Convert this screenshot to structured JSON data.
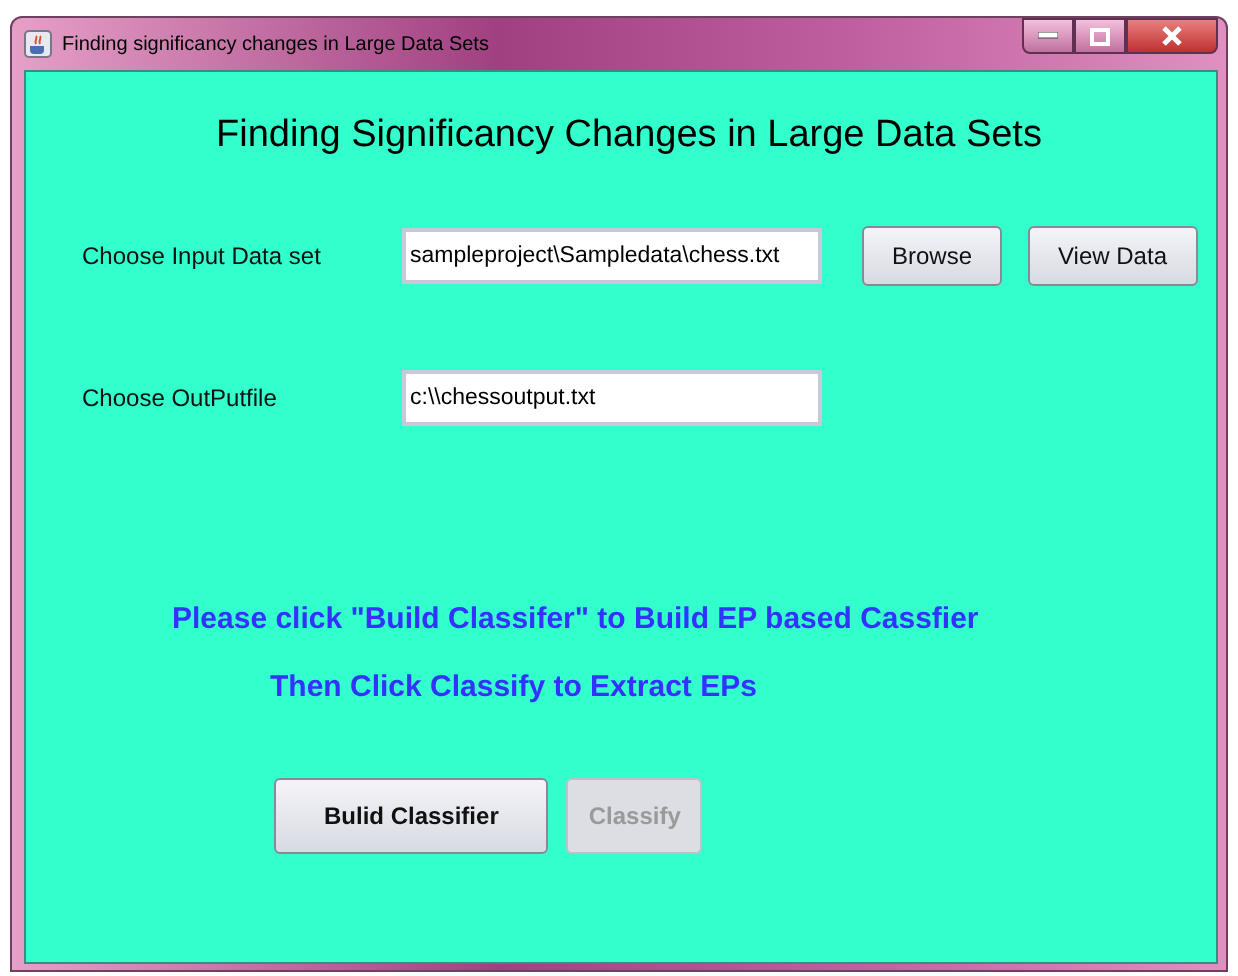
{
  "window": {
    "title": "Finding significancy changes in Large Data Sets"
  },
  "heading": "Finding Significancy Changes in Large Data Sets",
  "input_row": {
    "label": "Choose Input Data set",
    "value": "sampleproject\\Sampledata\\chess.txt",
    "buttons": [
      {
        "label": "Browse",
        "disabled": false
      },
      {
        "label": "View Data",
        "disabled": false
      }
    ]
  },
  "output_row": {
    "label": "Choose OutPutfile",
    "value": "c:\\\\chessoutput.txt"
  },
  "messages": [
    "Please click \"Build Classifer\" to Build EP based Cassfier",
    "Then Click Classify to Extract EPs"
  ],
  "actions": [
    {
      "label": "Bulid Classifier",
      "disabled": false
    },
    {
      "label": "Classify",
      "disabled": true
    }
  ]
}
